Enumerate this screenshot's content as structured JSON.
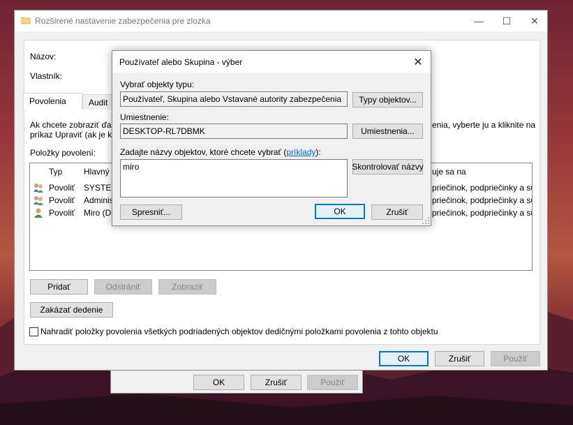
{
  "main_window": {
    "title": "Rozšírené nastavenie zabezpečenia pre zlozka",
    "minimize_glyph": "—",
    "maximize_glyph": "☐",
    "close_glyph": "✕",
    "name_label": "Názov:",
    "owner_label": "Vlastník:",
    "tabs": [
      {
        "label": "Povolenia"
      },
      {
        "label": "Audit"
      }
    ],
    "info_left": "Ak chcete zobraziť ďal",
    "info_left2": "príkaz Upraviť (ak je k",
    "info_right": "enia, vyberte ju a kliknite na",
    "permissions_label": "Položky povolení:",
    "columns": {
      "type": "Typ",
      "principal": "Hlavný",
      "applies": "uje sa na"
    },
    "rows": [
      {
        "type": "Povoliť",
        "principal": "SYSTEM",
        "applies": "priečinok, podpriečinky a súbory"
      },
      {
        "type": "Povoliť",
        "principal": "Adminis",
        "applies": "priečinok, podpriečinky a súbory"
      },
      {
        "type": "Povoliť",
        "principal": "Miro (D",
        "applies": "priečinok, podpriečinky a súbory"
      }
    ],
    "add_button": "Pridať",
    "remove_button": "Odstrániť",
    "view_button": "Zobraziť",
    "disable_inheritance_button": "Zakázať dedenie",
    "replace_checkbox_label": "Nahradiť položky povolenia všetkých podriadených objektov dedičnými položkami povolenia z tohto objektu",
    "ok_button": "OK",
    "cancel_button": "Zrušiť",
    "apply_button": "Použiť"
  },
  "back_dialog": {
    "ok_button": "OK",
    "cancel_button": "Zrušiť",
    "apply_button": "Použiť"
  },
  "select_dialog": {
    "title": "Používateľ alebo Skupina - výber",
    "close_glyph": "✕",
    "object_type_label": "Vybrať objekty typu:",
    "object_type_value": "Používateľ, Skupina alebo Vstavané autority zabezpečenia",
    "object_types_button": "Typy objektov...",
    "location_label": "Umiestnenie:",
    "location_value": "DESKTOP-RL7DBMK",
    "locations_button": "Umiestnenia...",
    "enter_names_label": "Zadajte názvy objektov, ktoré chcete vybrať (",
    "examples_link": "príklady",
    "enter_names_suffix": "):",
    "names_value": "miro",
    "check_names_button": "Skontrolovať názvy",
    "advanced_button": "Spresniť...",
    "ok_button": "OK",
    "cancel_button": "Zrušiť"
  }
}
